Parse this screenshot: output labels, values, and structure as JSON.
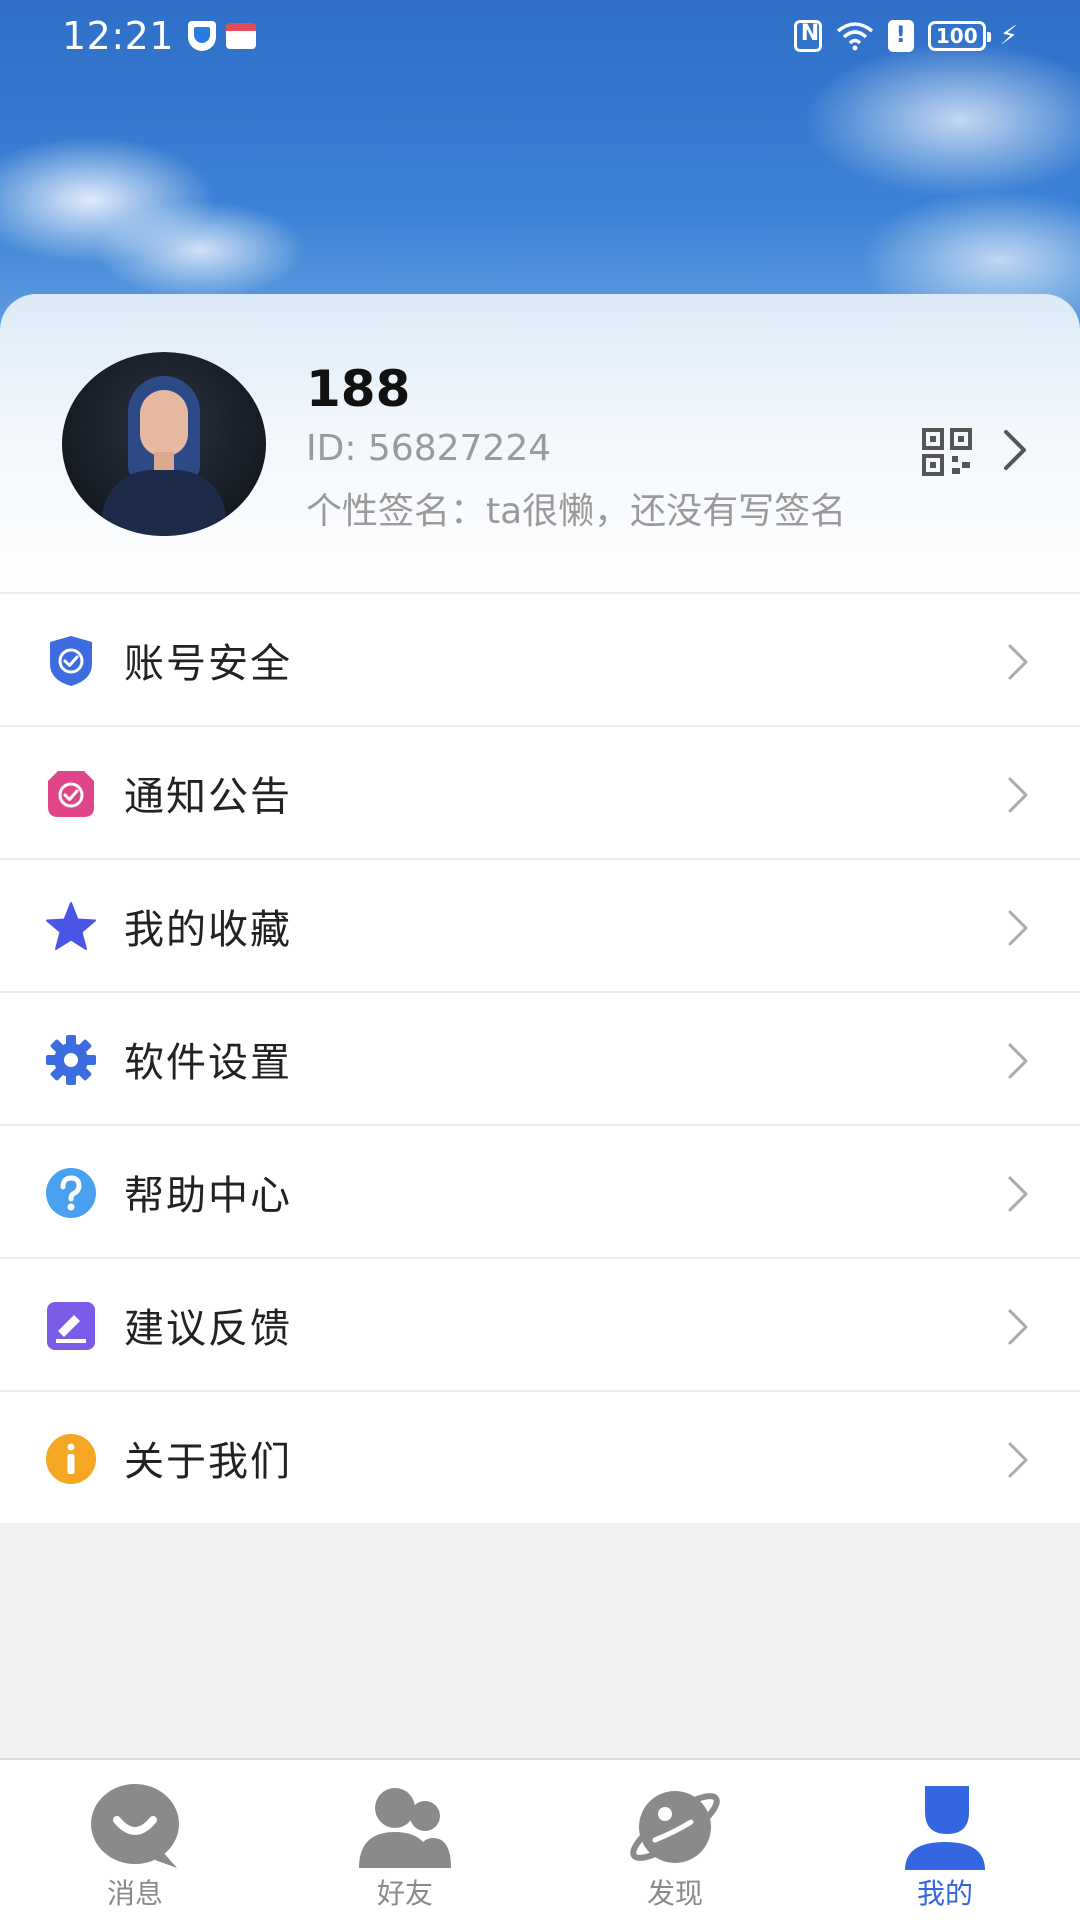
{
  "status_bar": {
    "time": "12:21",
    "battery": "100",
    "icons": [
      "security-shield-icon",
      "app-notification-icon",
      "nfc-icon",
      "wifi-icon",
      "alert-icon",
      "battery-icon",
      "charging-icon"
    ]
  },
  "profile": {
    "name": "188",
    "id_text": "ID:  56827224",
    "signature": "个性签名：ta很懒，还没有写签名",
    "qr_icon": "qr-code-icon",
    "chevron_icon": "chevron-right-icon"
  },
  "menu": {
    "items": [
      {
        "label": "账号安全",
        "icon": "shield-check-icon",
        "color": "#3d6be0"
      },
      {
        "label": "通知公告",
        "icon": "notification-check-icon",
        "color": "#e0458a"
      },
      {
        "label": "我的收藏",
        "icon": "star-icon",
        "color": "#4a55e8"
      },
      {
        "label": "软件设置",
        "icon": "gear-icon",
        "color": "#3d6be0"
      },
      {
        "label": "帮助中心",
        "icon": "help-icon",
        "color": "#4aa0f0"
      },
      {
        "label": "建议反馈",
        "icon": "feedback-icon",
        "color": "#7a5ce8"
      },
      {
        "label": "关于我们",
        "icon": "info-icon",
        "color": "#f5a623"
      }
    ]
  },
  "tabbar": {
    "tabs": [
      {
        "label": "消息",
        "icon": "chat-bubble-icon",
        "active": false
      },
      {
        "label": "好友",
        "icon": "friends-icon",
        "active": false
      },
      {
        "label": "发现",
        "icon": "planet-icon",
        "active": false
      },
      {
        "label": "我的",
        "icon": "person-icon",
        "active": true
      }
    ],
    "active_color": "#3366e0",
    "inactive_color": "#8a8a8a"
  }
}
